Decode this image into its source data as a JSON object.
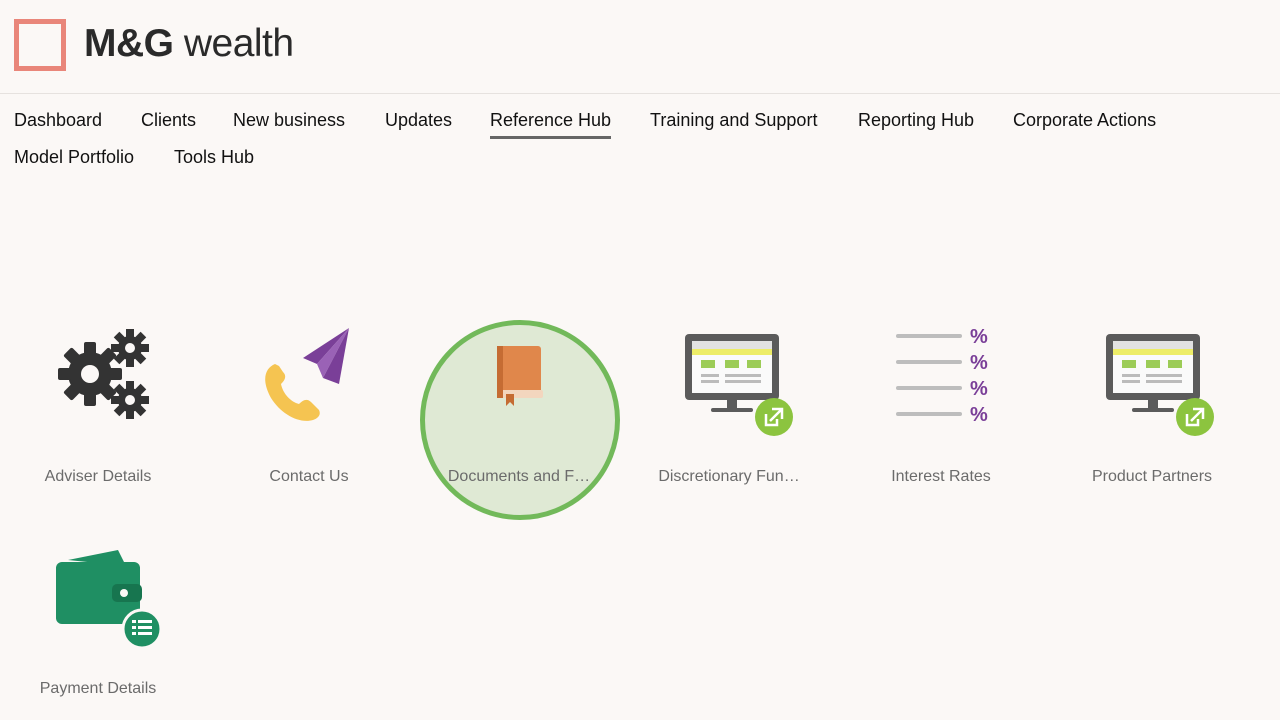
{
  "brand": {
    "name_bold": "M&G",
    "name_rest": " wealth",
    "accent": "#e9867a"
  },
  "nav": {
    "items": [
      {
        "label": "Dashboard"
      },
      {
        "label": "Clients"
      },
      {
        "label": "New business"
      },
      {
        "label": "Updates"
      },
      {
        "label": "Reference Hub",
        "active": true
      },
      {
        "label": "Training and Support"
      },
      {
        "label": "Reporting Hub"
      },
      {
        "label": "Corporate Actions"
      },
      {
        "label": "Model Portfolio"
      },
      {
        "label": "Tools Hub"
      }
    ]
  },
  "tiles": [
    {
      "label": "Adviser Details",
      "icon": "gears-icon"
    },
    {
      "label": "Contact Us",
      "icon": "phone-paper-plane-icon"
    },
    {
      "label": "Documents and F…",
      "icon": "book-icon",
      "highlighted": true
    },
    {
      "label": "Discretionary Fun…",
      "icon": "monitor-external-link-icon"
    },
    {
      "label": "Interest Rates",
      "icon": "percent-list-icon"
    },
    {
      "label": "Product Partners",
      "icon": "monitor-external-link-icon"
    },
    {
      "label": "Payment Details",
      "icon": "wallet-list-icon"
    }
  ],
  "colors": {
    "highlight_ring": "#72b95a",
    "highlight_fill": "#dfe9d4",
    "wallet": "#1f8f63",
    "percent": "#7a3f98",
    "plane": "#7a3f98",
    "phone": "#f5c451",
    "book": "#e0874b",
    "link_badge": "#8cc43f"
  }
}
